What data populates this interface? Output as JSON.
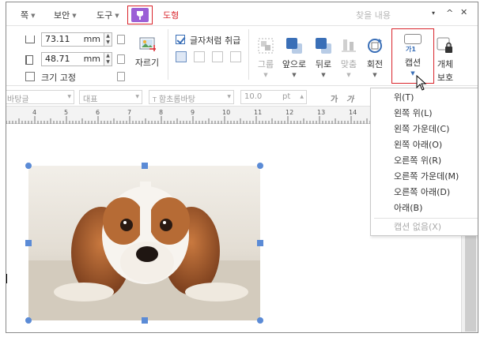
{
  "menubar": {
    "items": [
      "쪽",
      "보안",
      "도구"
    ],
    "shape_tab_label": "도형",
    "search_placeholder": "찾을 내용",
    "search_dropdown_glyph": "▾",
    "collapse_glyph": "^",
    "close_glyph": "✕"
  },
  "ribbon": {
    "width_value": "73.11",
    "height_value": "48.71",
    "unit": "mm",
    "fix_size_label": "크기 고정",
    "crop_label": "자르기",
    "treat_as_char_label": "글자처럼 취급",
    "treat_as_char_checked": true,
    "buttons": {
      "group": "그룹",
      "bring_front": "앞으로",
      "send_back": "뒤로",
      "align": "맞춤",
      "rotate": "회전",
      "caption": "캡션",
      "protect_line1": "개체",
      "protect_line2": "보호"
    },
    "caption_icon_text": "가1"
  },
  "format_bar": {
    "style": "바탕글",
    "language": "대표",
    "font": "함초롬바탕",
    "font_prefix": "T",
    "size": "10.0",
    "size_unit": "pt",
    "bold": "가",
    "italic": "가"
  },
  "ruler": {
    "labels": [
      "4",
      "5",
      "6",
      "7",
      "8",
      "9",
      "10",
      "11",
      "12",
      "13",
      "14"
    ]
  },
  "caption_menu": {
    "items": [
      {
        "label": "위(T)",
        "enabled": true
      },
      {
        "label": "왼쪽 위(L)",
        "enabled": true
      },
      {
        "label": "왼쪽 가운데(C)",
        "enabled": true
      },
      {
        "label": "왼쪽 아래(O)",
        "enabled": true
      },
      {
        "label": "오른쪽 위(R)",
        "enabled": true
      },
      {
        "label": "오른쪽 가운데(M)",
        "enabled": true
      },
      {
        "label": "오른쪽 아래(D)",
        "enabled": true
      },
      {
        "label": "아래(B)",
        "enabled": true
      },
      {
        "label": "캡션 없음(X)",
        "enabled": false
      }
    ]
  },
  "colors": {
    "accent_red": "#d9242b",
    "shape_tab_purple": "#9b5fd6",
    "selection_handle": "#5b8bd6",
    "button_blue": "#3a6fb7"
  },
  "icons": [
    "drawing-object-icon",
    "crop-icon",
    "group-icon",
    "bring-front-icon",
    "send-back-icon",
    "align-icon",
    "rotate-icon",
    "caption-icon",
    "object-protect-icon",
    "mouse-pointer-icon"
  ]
}
